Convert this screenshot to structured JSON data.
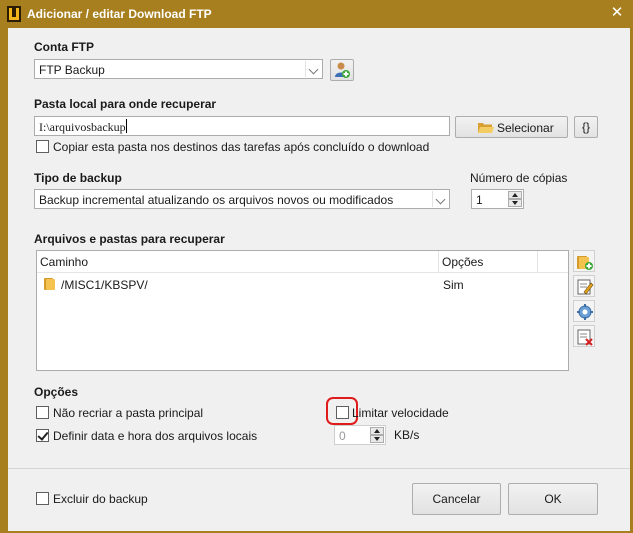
{
  "window": {
    "title": "Adicionar / editar Download FTP",
    "close_glyph": "✕"
  },
  "ftp_account": {
    "section_label": "Conta FTP",
    "selected": "FTP Backup",
    "manage_icon": "user-add-icon"
  },
  "local_folder": {
    "section_label": "Pasta local para onde recuperar",
    "value": "I:\\arquivosbackup",
    "select_button": "Selecionar",
    "variables_button": "{}",
    "copy_checkbox_label": "Copiar esta pasta nos destinos das tarefas após concluído o download",
    "copy_checked": false
  },
  "backup_type": {
    "section_label": "Tipo de backup",
    "selected": "Backup incremental atualizando os arquivos novos ou modificados",
    "copies_label": "Número de cópias",
    "copies_value": "1"
  },
  "files": {
    "section_label": "Arquivos e pastas para recuperar",
    "columns": [
      "Caminho",
      "Opções"
    ],
    "rows": [
      {
        "path": "/MISC1/KBSPV/",
        "options": "Sim"
      }
    ],
    "side_buttons": [
      "add-folder-icon",
      "edit-icon",
      "settings-icon",
      "delete-icon"
    ]
  },
  "options": {
    "section_label": "Opções",
    "no_recreate_label": "Não recriar a pasta principal",
    "no_recreate_checked": false,
    "set_datetime_label": "Definir data e hora dos arquivos locais",
    "set_datetime_checked": true,
    "limit_speed_label": "Limitar velocidade",
    "limit_speed_checked": false,
    "speed_value": "0",
    "speed_unit": "KB/s"
  },
  "footer": {
    "exclude_label": "Excluir do backup",
    "exclude_checked": false,
    "cancel_button": "Cancelar",
    "ok_button": "OK"
  },
  "colors": {
    "titlebar": "#a77f1e",
    "client_bg": "#f0f0f0",
    "highlight": "#e01b1b",
    "folder": "#e8b846"
  }
}
